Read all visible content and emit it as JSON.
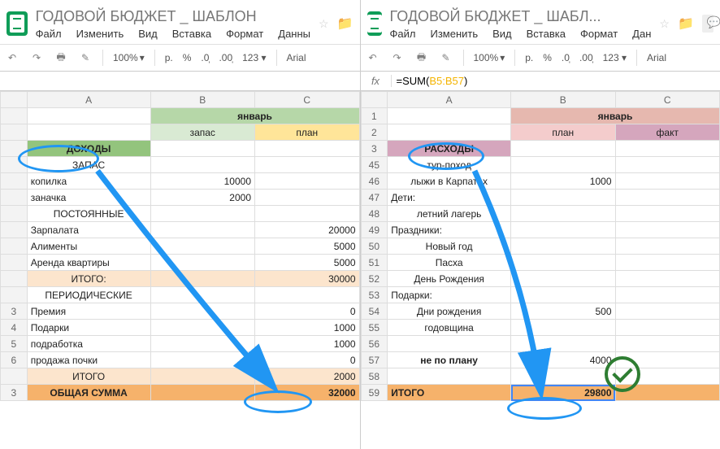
{
  "left": {
    "title": "ГОДОВОЙ БЮДЖЕТ _ ШАБЛОН",
    "menus": [
      "Файл",
      "Изменить",
      "Вид",
      "Вставка",
      "Формат",
      "Данны"
    ],
    "zoom": "100%",
    "currency": "р.",
    "font": "Arial",
    "cols": [
      "A",
      "B",
      "C"
    ],
    "month": "январь",
    "sub_b": "запас",
    "sub_c": "план",
    "section_income": "ДОХОДЫ",
    "r4": "ЗАПАС",
    "rows": [
      {
        "a": "копилка",
        "b": "10000"
      },
      {
        "a": "заначка",
        "b": "2000"
      }
    ],
    "sect_const": "ПОСТОЯННЫЕ",
    "const_rows": [
      {
        "a": "Зарпалата",
        "c": "20000"
      },
      {
        "a": "Алименты",
        "c": "5000"
      },
      {
        "a": "Аренда квартиры",
        "c": "5000"
      }
    ],
    "itogo": "ИТОГО:",
    "itogo_val": "30000",
    "sect_per": "ПЕРИОДИЧЕСКИЕ",
    "per_rows": [
      {
        "n": "3",
        "a": "Премия",
        "c": "0"
      },
      {
        "n": "4",
        "a": "Подарки",
        "c": "1000"
      },
      {
        "n": "5",
        "a": "подработка",
        "c": "1000"
      },
      {
        "n": "6",
        "a": "продажа почки",
        "c": "0"
      }
    ],
    "itogo2": "ИТОГО",
    "itogo2_val": "2000",
    "grand": "ОБЩАЯ СУММА",
    "grand_val": "32000",
    "grand_n": "3"
  },
  "right": {
    "title": "ГОДОВОЙ БЮДЖЕТ _ ШАБЛ...",
    "menus": [
      "Файл",
      "Изменить",
      "Вид",
      "Вставка",
      "Формат",
      "Дан"
    ],
    "zoom": "100%",
    "currency": "р.",
    "font": "Arial",
    "formula_fn": "=SUM(",
    "formula_range": "B5:B57",
    "formula_end": ")",
    "cols": [
      "A",
      "B",
      "C"
    ],
    "month": "январь",
    "sub_b": "план",
    "sub_c": "факт",
    "section_expense": "РАСХОДЫ",
    "rows": [
      {
        "n": "1"
      },
      {
        "n": "2"
      },
      {
        "n": "3"
      },
      {
        "n": "45",
        "a": "тур-поход"
      },
      {
        "n": "46",
        "a": "лыжи в Карпатах",
        "b": "1000"
      },
      {
        "n": "47",
        "a": "Дети:"
      },
      {
        "n": "48",
        "a": "летний лагерь"
      },
      {
        "n": "49",
        "a": "Праздники:"
      },
      {
        "n": "50",
        "a": "Новый год"
      },
      {
        "n": "51",
        "a": "Пасха"
      },
      {
        "n": "52",
        "a": "День Рождения"
      },
      {
        "n": "53",
        "a": "Подарки:"
      },
      {
        "n": "54",
        "a": "Дни рождения",
        "b": "500"
      },
      {
        "n": "55",
        "a": "годовщина"
      },
      {
        "n": "56"
      }
    ],
    "np_n": "57",
    "np": "не по плану",
    "np_val": "4000",
    "blank_n": "58",
    "total_n": "59",
    "total": "ИТОГО",
    "total_val": "29800"
  }
}
